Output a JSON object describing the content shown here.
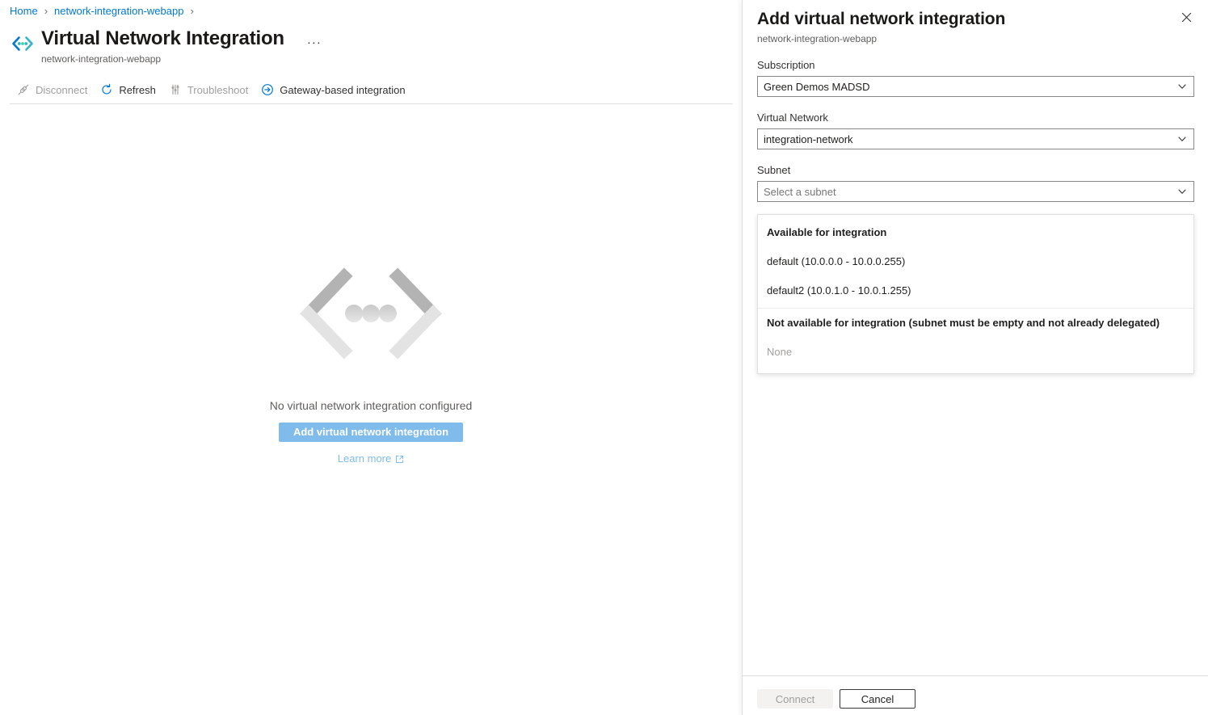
{
  "breadcrumb": {
    "items": [
      {
        "label": "Home",
        "name": "breadcrumb-home"
      },
      {
        "label": "network-integration-webapp",
        "name": "breadcrumb-webapp"
      }
    ],
    "separator": "›"
  },
  "header": {
    "icon": "virtual-network-integration-icon",
    "title": "Virtual Network Integration",
    "subtitle": "network-integration-webapp",
    "more_label": "···"
  },
  "toolbar": {
    "items": [
      {
        "label": "Disconnect",
        "icon": "disconnect-icon",
        "disabled": true,
        "name": "toolbar-disconnect"
      },
      {
        "label": "Refresh",
        "icon": "refresh-icon",
        "disabled": false,
        "name": "toolbar-refresh"
      },
      {
        "label": "Troubleshoot",
        "icon": "troubleshoot-icon",
        "disabled": true,
        "name": "toolbar-troubleshoot"
      },
      {
        "label": "Gateway-based integration",
        "icon": "arrow-right-circle-icon",
        "disabled": false,
        "name": "toolbar-gateway-based-integration"
      }
    ]
  },
  "empty_state": {
    "illustration": "chevron-dots-illustration",
    "message": "No virtual network integration configured",
    "primary_button": "Add virtual network integration",
    "learn_more": "Learn more",
    "learn_more_icon": "external-link-icon"
  },
  "panel": {
    "title": "Add virtual network integration",
    "subtitle": "network-integration-webapp",
    "close_icon": "close-icon",
    "fields": {
      "subscription": {
        "label": "Subscription",
        "value": "Green Demos MADSD",
        "icon": "chevron-down-icon"
      },
      "virtual_network": {
        "label": "Virtual Network",
        "value": "integration-network",
        "icon": "chevron-down-icon"
      },
      "subnet": {
        "label": "Subnet",
        "placeholder": "Select a subnet",
        "value": "Select a subnet",
        "icon": "chevron-down-icon"
      }
    },
    "subnet_dropdown": {
      "groups": [
        {
          "header": "Available for integration",
          "options": [
            {
              "label": "default (10.0.0.0 - 10.0.0.255)",
              "disabled": false
            },
            {
              "label": "default2 (10.0.1.0 - 10.0.1.255)",
              "disabled": false
            }
          ]
        },
        {
          "header": "Not available for integration (subnet must be empty and not already delegated)",
          "options": [
            {
              "label": "None",
              "disabled": true
            }
          ]
        }
      ]
    },
    "footer": {
      "connect_label": "Connect",
      "cancel_label": "Cancel"
    }
  },
  "colors": {
    "link": "#0078d4",
    "primary_button": "#7fbbeb",
    "text": "#201f1e",
    "muted": "#605e5c",
    "disabled": "#a19f9d",
    "border": "#e1dfdd"
  }
}
